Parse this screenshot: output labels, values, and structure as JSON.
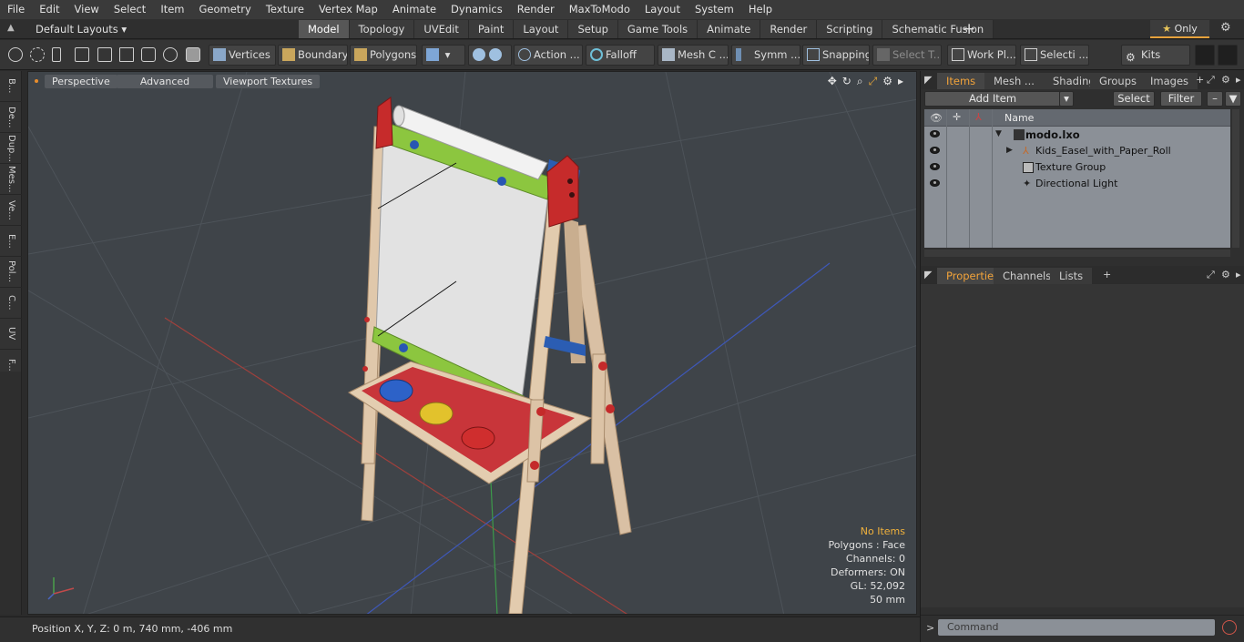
{
  "menu": [
    "File",
    "Edit",
    "View",
    "Select",
    "Item",
    "Geometry",
    "Texture",
    "Vertex Map",
    "Animate",
    "Dynamics",
    "Render",
    "MaxToModo",
    "Layout",
    "System",
    "Help"
  ],
  "layouts_label": "Default Layouts",
  "mode_tabs": [
    "Model",
    "Topology",
    "UVEdit",
    "Paint",
    "Layout",
    "Setup",
    "Game Tools",
    "Animate",
    "Render",
    "Scripting",
    "Schematic Fusion"
  ],
  "active_mode_tab": "Model",
  "only_label": "Only",
  "toolbar": {
    "vertices": "Vertices",
    "boundary": "Boundary",
    "polygons": "Polygons",
    "action": "Action ...",
    "falloff": "Falloff",
    "mesh_c": "Mesh C ...",
    "symm": "Symm ...",
    "snapping": "Snapping",
    "select_t": "Select T...",
    "work_pl": "Work Pl...",
    "selecti": "Selecti ...",
    "kits": "Kits"
  },
  "left_strip": [
    "B...",
    "De...",
    "Dup...",
    "Mes...",
    "Ve...",
    "E...",
    "Pol...",
    "C...",
    "UV",
    "F..."
  ],
  "viewport": {
    "perspective": "Perspective",
    "advanced": "Advanced",
    "viewport_textures": "Viewport Textures",
    "info": {
      "no_items": "No Items",
      "polygons": "Polygons : Face",
      "channels": "Channels: 0",
      "deformers": "Deformers: ON",
      "gl": "GL: 52,092",
      "scale": "50 mm"
    }
  },
  "status": {
    "position": "Position X, Y, Z:   0 m, 740 mm, -406 mm"
  },
  "right_panel": {
    "top_tabs": [
      "Items",
      "Mesh ...",
      "Shading",
      "Groups",
      "Images"
    ],
    "active_top_tab": "Items",
    "add_item": "Add Item",
    "select": "Select",
    "filter": "Filter",
    "name_header": "Name",
    "items": [
      {
        "label": "modo.lxo",
        "indent": 0
      },
      {
        "label": "Kids_Easel_with_Paper_Roll",
        "indent": 1
      },
      {
        "label": "Texture Group",
        "indent": 1
      },
      {
        "label": "Directional Light",
        "indent": 1
      }
    ],
    "bottom_tabs": [
      "Properties",
      "Channels",
      "Lists"
    ],
    "active_bottom_tab": "Properties",
    "command_placeholder": "Command"
  }
}
